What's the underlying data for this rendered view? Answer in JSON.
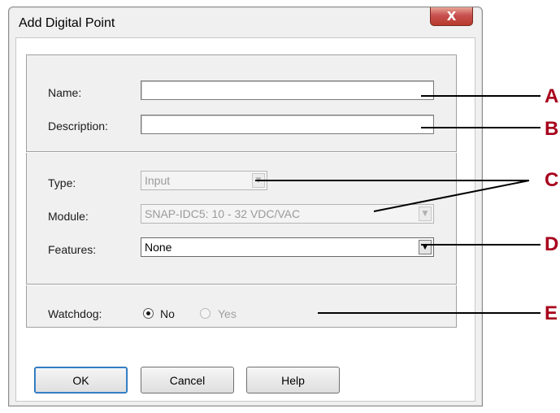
{
  "dialog": {
    "title": "Add Digital Point",
    "close_glyph": "X"
  },
  "fields": {
    "name_label": "Name:",
    "name_value": "",
    "description_label": "Description:",
    "description_value": "",
    "type_label": "Type:",
    "type_value": "Input",
    "module_label": "Module:",
    "module_value": "SNAP-IDC5: 10 - 32 VDC/VAC",
    "features_label": "Features:",
    "features_value": "None",
    "watchdog_label": "Watchdog:",
    "watchdog_no": "No",
    "watchdog_yes": "Yes",
    "watchdog_selected": "No"
  },
  "buttons": {
    "ok": "OK",
    "cancel": "Cancel",
    "help": "Help"
  },
  "callouts": [
    "A",
    "B",
    "C",
    "D",
    "E"
  ],
  "colors": {
    "callout": "#a8001c",
    "close_button": "#c75050"
  }
}
